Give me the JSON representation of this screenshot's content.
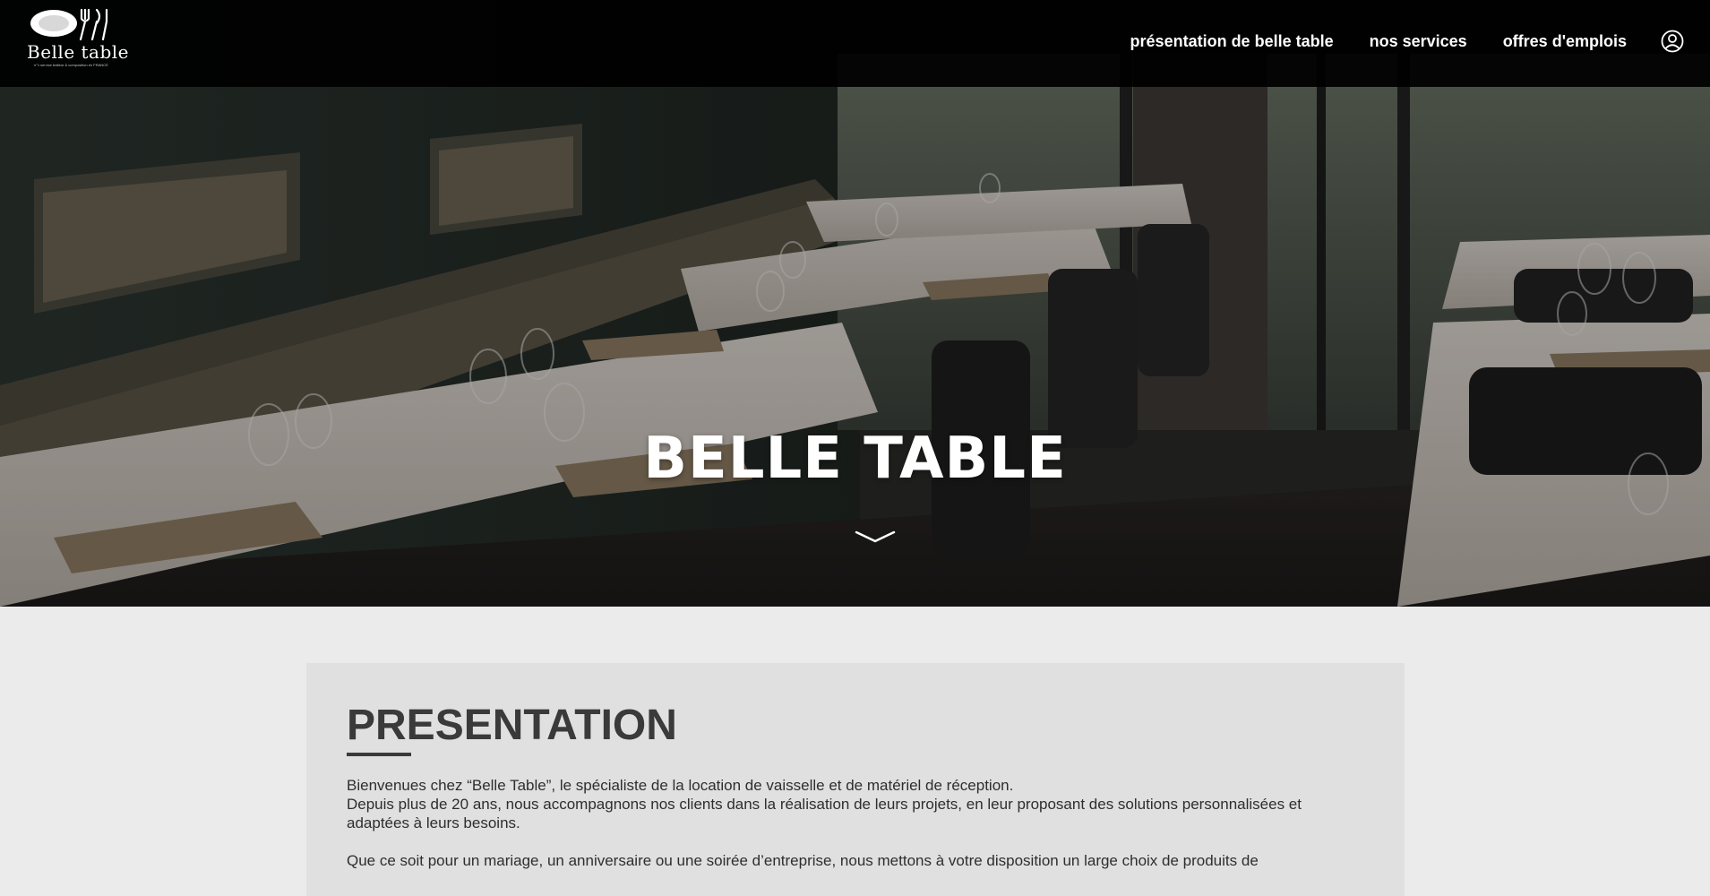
{
  "brand": {
    "name": "Belle table",
    "tagline": "n°1 service traiteur & composition en FRANCE"
  },
  "nav": {
    "items": [
      {
        "label": "présentation de belle table"
      },
      {
        "label": "nos services"
      },
      {
        "label": "offres d'emplois"
      }
    ],
    "user_icon": "user-circle-icon"
  },
  "hero": {
    "title": "BELLE TABLE",
    "scroll_icon": "chevron-down-icon"
  },
  "presentation": {
    "title": "PRESENTATION",
    "paragraph1_line1": "Bienvenues chez “Belle Table”, le spécialiste de la location de vaisselle et de matériel de réception.",
    "paragraph1_line2": "Depuis plus de 20 ans, nous accompagnons nos clients dans la réalisation de leurs projets, en leur proposant des solutions personnalisées et adaptées à leurs besoins.",
    "paragraph2": "Que ce soit pour un mariage, un anniversaire ou une soirée d’entreprise, nous mettons à votre disposition un large choix de produits de"
  },
  "colors": {
    "navbar_bg": "#000000",
    "page_bg": "#ebebeb",
    "card_bg": "#e0e0e0",
    "heading": "#3a3a3a",
    "hero_text": "#ffffff"
  }
}
